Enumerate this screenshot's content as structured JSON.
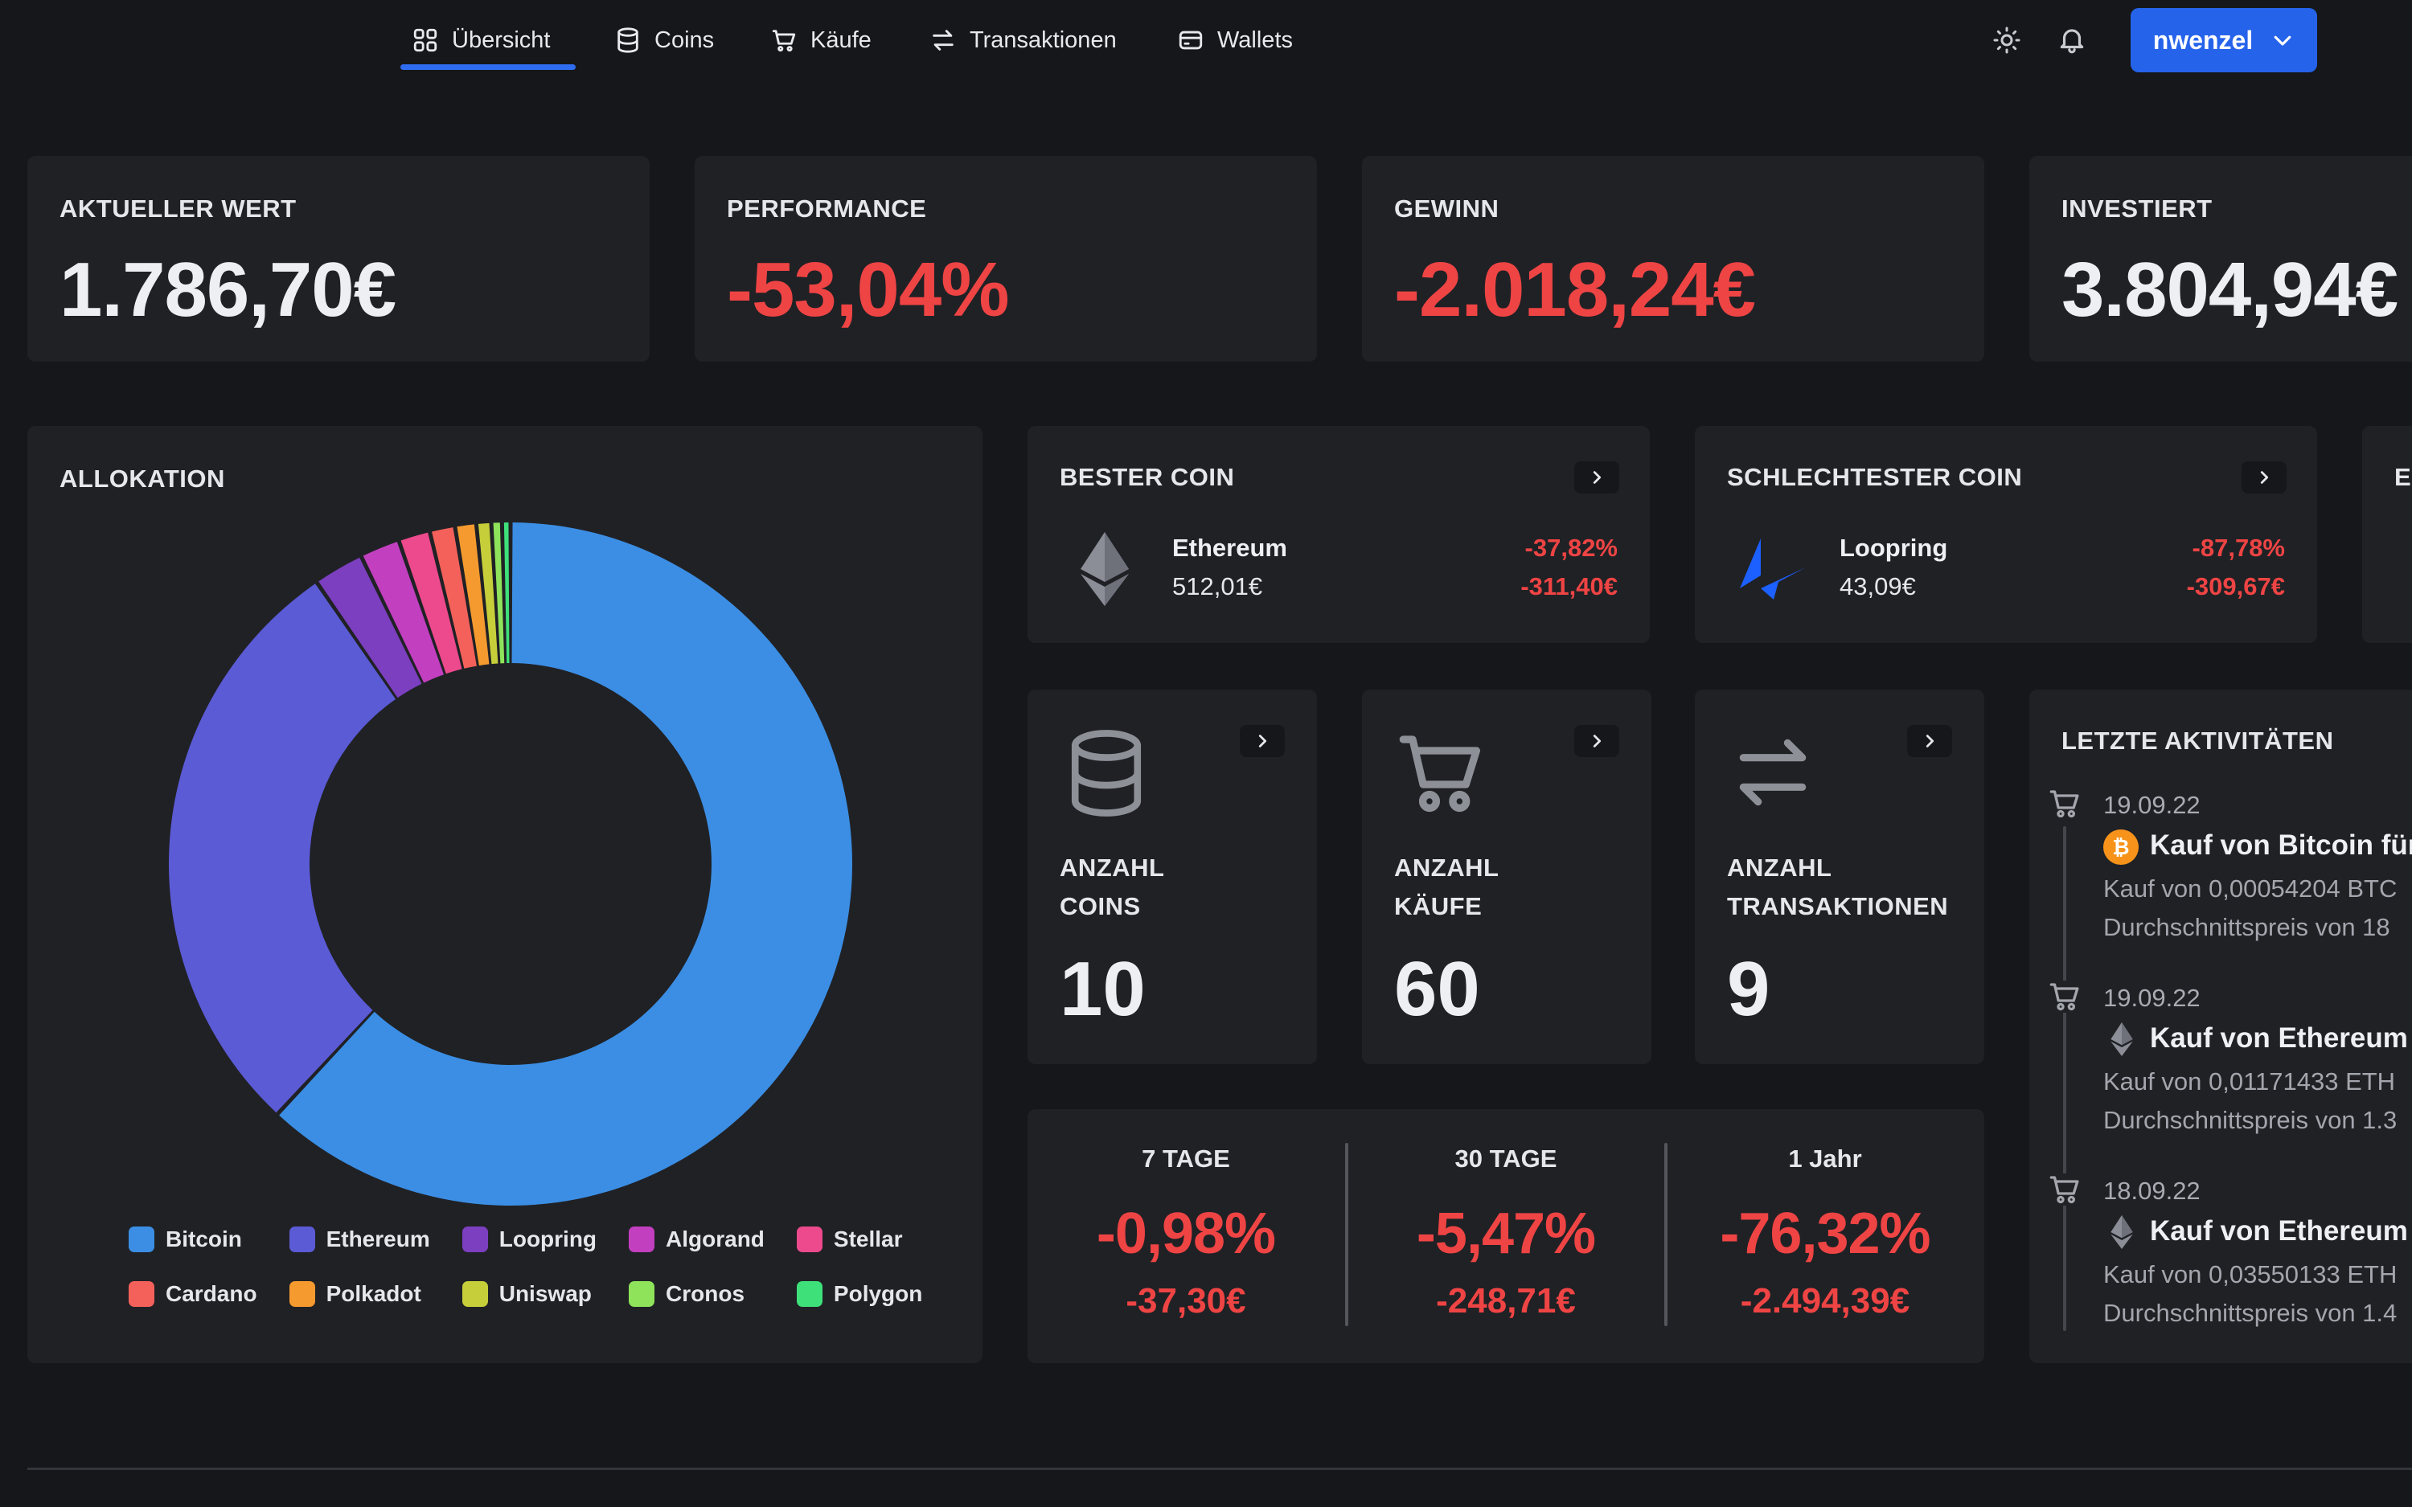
{
  "nav": {
    "items": [
      {
        "label": "Übersicht",
        "icon": "grid-icon"
      },
      {
        "label": "Coins",
        "icon": "database-icon"
      },
      {
        "label": "Käufe",
        "icon": "cart-icon"
      },
      {
        "label": "Transaktionen",
        "icon": "arrows-exchange-icon"
      },
      {
        "label": "Wallets",
        "icon": "wallet-icon"
      }
    ],
    "active": "Übersicht",
    "user": "nwenzel"
  },
  "stats": {
    "current_value": {
      "label": "AKTUELLER WERT",
      "value": "1.786,70€"
    },
    "performance": {
      "label": "PERFORMANCE",
      "value": "-53,04%"
    },
    "profit": {
      "label": "GEWINN",
      "value": "-2.018,24€"
    },
    "invested": {
      "label": "INVESTIERT",
      "value": "3.804,94€"
    }
  },
  "allocation": {
    "title": "ALLOKATION",
    "legend": [
      {
        "name": "Bitcoin",
        "color": "#3b8ee4"
      },
      {
        "name": "Ethereum",
        "color": "#5b5bd6"
      },
      {
        "name": "Loopring",
        "color": "#7c3fc0"
      },
      {
        "name": "Algorand",
        "color": "#c23fc0"
      },
      {
        "name": "Stellar",
        "color": "#ec4a8c"
      },
      {
        "name": "Cardano",
        "color": "#f4615a"
      },
      {
        "name": "Polkadot",
        "color": "#f59a2f"
      },
      {
        "name": "Uniswap",
        "color": "#c6cf3a"
      },
      {
        "name": "Cronos",
        "color": "#8ee35a"
      },
      {
        "name": "Polygon",
        "color": "#3ee07a"
      }
    ]
  },
  "chart_data": {
    "type": "pie",
    "categories": [
      "Bitcoin",
      "Ethereum",
      "Loopring",
      "Algorand",
      "Stellar",
      "Cardano",
      "Polkadot",
      "Uniswap",
      "Cronos",
      "Polygon"
    ],
    "values": [
      62,
      28.5,
      2.4,
      1.9,
      1.5,
      1.2,
      1.0,
      0.7,
      0.5,
      0.4
    ],
    "title": "ALLOKATION",
    "legend": "bottom"
  },
  "best_coin": {
    "label": "BESTER COIN",
    "name": "Ethereum",
    "value": "512,01€",
    "pct": "-37,82%",
    "abs": "-311,40€"
  },
  "worst_coin": {
    "label": "SCHLECHTESTER COIN",
    "name": "Loopring",
    "value": "43,09€",
    "pct": "-87,78%",
    "abs": "-309,67€"
  },
  "counts": {
    "coins": {
      "label1": "ANZAHL",
      "label2": "COINS",
      "value": "10"
    },
    "purchases": {
      "label1": "ANZAHL",
      "label2": "KÄUFE",
      "value": "60"
    },
    "transactions": {
      "label1": "ANZAHL",
      "label2": "TRANSAKTIONEN",
      "value": "9"
    }
  },
  "periods": [
    {
      "label": "7 TAGE",
      "pct": "-0,98%",
      "abs": "-37,30€"
    },
    {
      "label": "30 TAGE",
      "pct": "-5,47%",
      "abs": "-248,71€"
    },
    {
      "label": "1 Jahr",
      "pct": "-76,32%",
      "abs": "-2.494,39€"
    }
  ],
  "activities": {
    "title": "LETZTE AKTIVITÄTEN",
    "items": [
      {
        "date": "19.09.22",
        "title": "Kauf von Bitcoin für",
        "line1": "Kauf von 0,00054204 BTC",
        "line2": "Durchschnittspreis von 18"
      },
      {
        "date": "19.09.22",
        "title": "Kauf von Ethereum",
        "line1": "Kauf von 0,01171433 ETH",
        "line2": "Durchschnittspreis von 1.3"
      },
      {
        "date": "18.09.22",
        "title": "Kauf von Ethereum",
        "line1": "Kauf von 0,03550133 ETH",
        "line2": "Durchschnittspreis von 1.4"
      }
    ]
  },
  "colors": {
    "accent": "#2563eb",
    "negative": "#ef4444",
    "card": "#202125",
    "background": "#16171a"
  }
}
